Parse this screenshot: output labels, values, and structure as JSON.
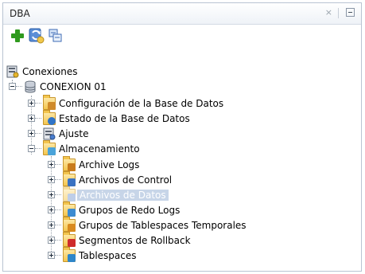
{
  "panel": {
    "title": "DBA",
    "close_glyph": "×"
  },
  "toolbar": {
    "buttons": [
      {
        "icon": "add-connection-icon"
      },
      {
        "icon": "refresh-icon"
      },
      {
        "icon": "collapse-all-icon"
      }
    ]
  },
  "tree": {
    "root": "Conexiones",
    "connection": "CONEXION 01",
    "nodes": [
      "Configuración de la Base de Datos",
      "Estado de la Base de Datos",
      "Ajuste",
      "Almacenamiento"
    ],
    "storage_children": [
      "Archive Logs",
      "Archivos de Control",
      "Archivos de Datos",
      "Grupos de Redo Logs",
      "Grupos de Tablespaces Temporales",
      "Segmentos de Rollback",
      "Tablespaces"
    ]
  },
  "colors": {
    "selection": "#c7d5e8",
    "folder": "#f3c54e",
    "border": "#b9c4d2"
  }
}
